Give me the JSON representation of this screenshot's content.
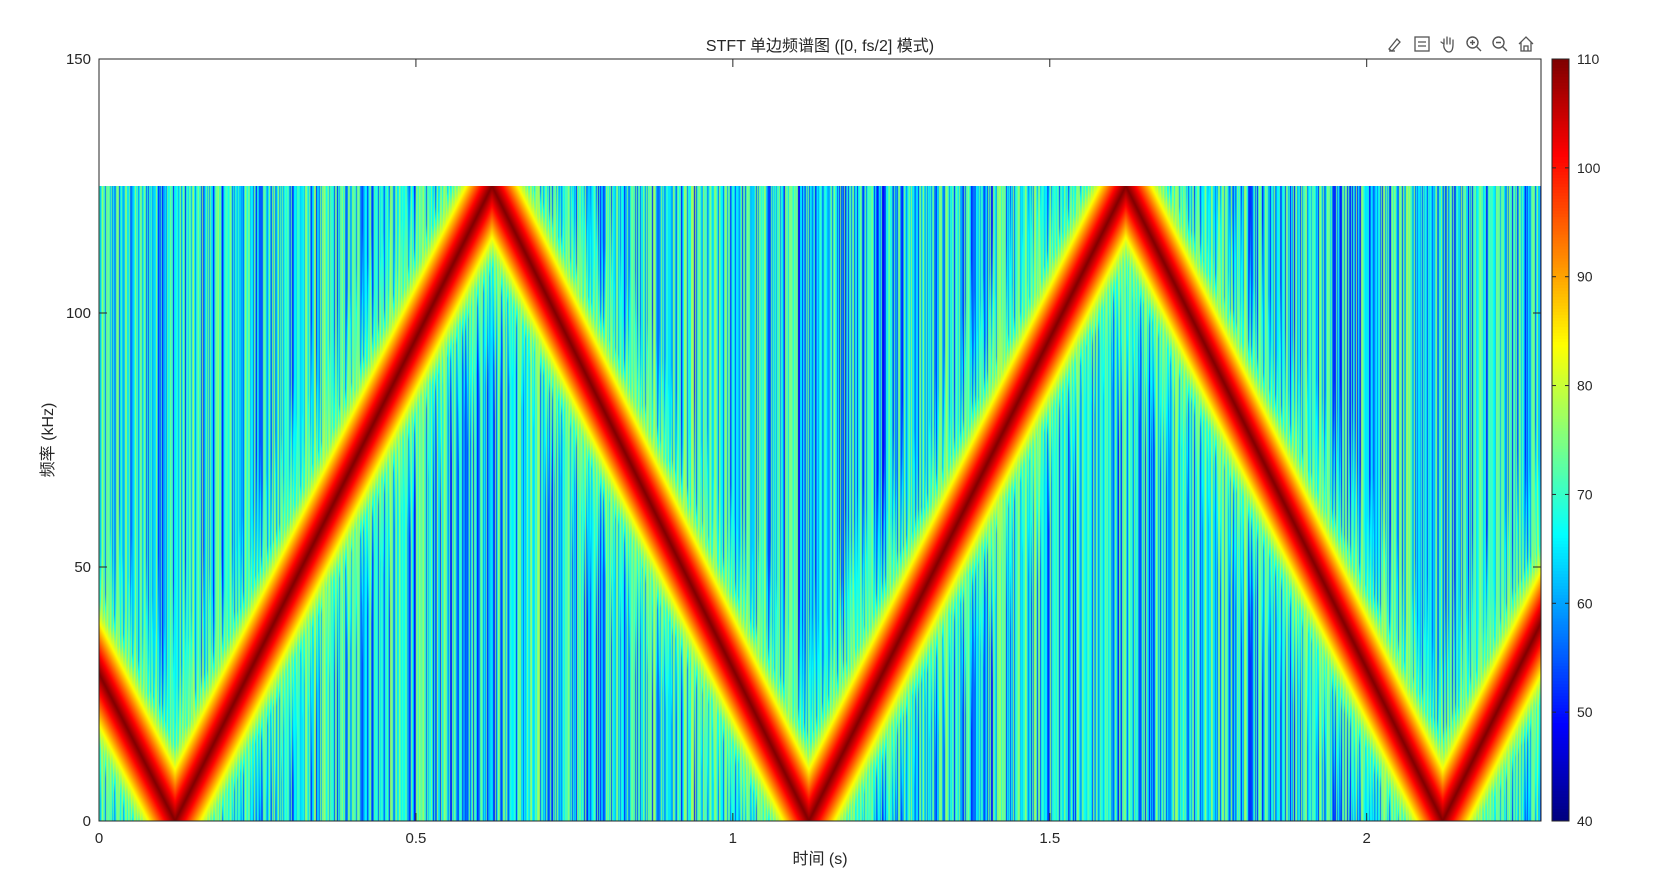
{
  "toolbar": {
    "icons": [
      "brush-icon",
      "datatip-icon",
      "pan-icon",
      "zoom-in-icon",
      "zoom-out-icon",
      "home-icon"
    ]
  },
  "chart_data": {
    "type": "heatmap",
    "title": "STFT 单边频谱图 ([0, fs/2] 模式)",
    "xlabel": "时间 (s)",
    "ylabel": "频率 (kHz)",
    "xlim": [
      0,
      2.275
    ],
    "ylim": [
      0,
      150
    ],
    "xticks": [
      0,
      0.5,
      1,
      1.5,
      2
    ],
    "xticklabels": [
      "0",
      "0.5",
      "1",
      "1.5",
      "2"
    ],
    "yticks": [
      0,
      50,
      100,
      150
    ],
    "yticklabels": [
      "0",
      "50",
      "100",
      "150"
    ],
    "data_extent": {
      "time_s": [
        0,
        2.275
      ],
      "freq_khz": [
        0,
        125
      ]
    },
    "colormap": "jet",
    "colorbar": {
      "clim": [
        40,
        110
      ],
      "ticks": [
        40,
        50,
        60,
        70,
        80,
        90,
        100,
        110
      ],
      "ticklabels": [
        "40",
        "50",
        "60",
        "70",
        "80",
        "90",
        "100",
        "110"
      ]
    },
    "ridge": {
      "description_values": "peak frequency (kHz) vs time (s) of the dominant triangular chirp",
      "time_s": [
        0,
        0.12,
        0.62,
        1.12,
        1.62,
        2.12,
        2.275
      ],
      "freq_khz": [
        29,
        0,
        125,
        0,
        125,
        0,
        39
      ],
      "peak_level": 110
    },
    "background_level_range": [
      45,
      85
    ]
  }
}
